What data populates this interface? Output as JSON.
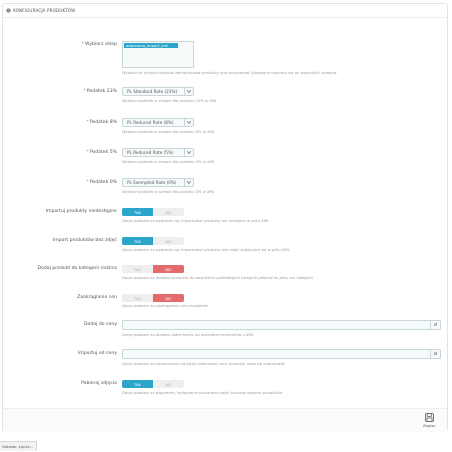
{
  "panel": {
    "title": "KONFIGURACJA PRODUKTÓW"
  },
  "fields": {
    "stores": {
      "label": "Wybierz sklep",
      "selected": "odarsoma_import_xml",
      "help": "Wybierz do których sklepów zaimportować produkty oraz przydzielać (kategorie importu) się do wszystkich sklepów"
    },
    "tax23": {
      "label": "Podatek 23%",
      "value": "PL Standard Rate (23%)",
      "help": "Wybierz podatek w sklepie dla podatku 23% w XML"
    },
    "tax8": {
      "label": "Podatek 8%",
      "value": "PL Reduced Rate (8%)",
      "help": "Wybierz podatek w sklepie dla podatku 8% w XML"
    },
    "tax5": {
      "label": "Podatek 5%",
      "value": "PL Reduced Rate (5%)",
      "help": "Wybierz podatek w sklepie dla podatku 5% w XML"
    },
    "tax0": {
      "label": "Podatek 0%",
      "value": "PL Exempted Rate (0%)",
      "help": "Wybierz podatek w sklepie dla podatku 0% w XML"
    },
    "import_unavailable": {
      "label": "Importuj produkty niedostępne",
      "yes": "TAK",
      "no": "NIE",
      "selected": "yes",
      "help": "Opcja pozwala na wybranie czy importować produkty nie dostępne w pliku XML"
    },
    "import_no_images": {
      "label": "Import produktów bez zdjęć",
      "yes": "TAK",
      "no": "NIE",
      "selected": "yes",
      "help": "Opcja pozwala na wybranie czy importować produkty bez zdjęć znajdujące się w pliku XML"
    },
    "add_to_parent": {
      "label": "Dodaj produkt do kategorii rodzica",
      "yes": "TAK",
      "no": "NIE",
      "selected": "no",
      "help": "Opcja pozwala na dodanie produktu do wszystkich podkategorii kategorii głównej do pliku xm kategorii"
    },
    "round_prices": {
      "label": "Zaokrąglanie cen",
      "yes": "TAK",
      "no": "NIE",
      "selected": "no",
      "help": "Opcja pozwala na zaokrąglenie cen produktów"
    },
    "add_to_price": {
      "label": "Dodaj do ceny",
      "value": "",
      "addon": "zł",
      "help": "Opcja pozwala na dodanie stałej kwoty do wszystkich produktów z XML"
    },
    "import_from_price": {
      "label": "Importuj od ceny",
      "value": "",
      "addon": "zł",
      "help": "Opcja pozwala na ograniczenie od jakiej minimalnej ceny produkty mają się importować"
    },
    "fetch_images": {
      "label": "Pobieraj zdjęcia",
      "yes": "TAK",
      "no": "NIE",
      "selected": "yes",
      "help": "Opcja pozwala na włączenie / wyłączenie pobierania zdjęć podczas importu produktów"
    }
  },
  "footer": {
    "save_label": "Zapisz"
  },
  "statusbar": {
    "text": "Gotowe. Łącze…"
  },
  "colors": {
    "accent": "#2ba5c9",
    "danger": "#e36b6b",
    "required": "#e05d5d"
  },
  "icons": {
    "heading": "gear-icon",
    "select": "chevron-down-icon",
    "save": "floppy-disk-icon"
  }
}
